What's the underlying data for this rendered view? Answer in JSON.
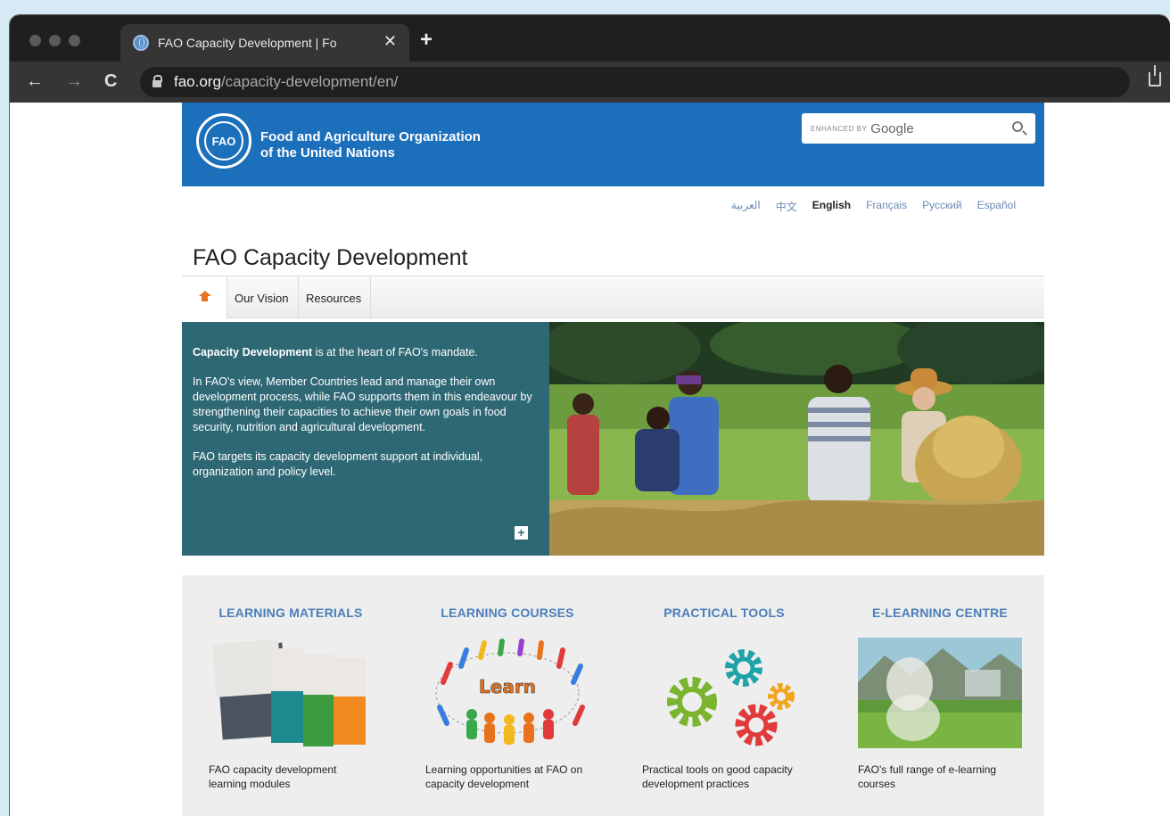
{
  "browser": {
    "tab_title": "FAO Capacity Development | Fo",
    "close_glyph": "✕",
    "new_tab_glyph": "+",
    "back_glyph": "←",
    "forward_glyph": "→",
    "reload_glyph": "C",
    "url_host": "fao.org",
    "url_path": "/capacity-development/en/"
  },
  "header": {
    "org_name_line1": "Food and Agriculture Organization",
    "org_name_line2": "of the United Nations",
    "logo_text": "FAO",
    "search_enhanced": "ENHANCED BY",
    "search_brand": "Google"
  },
  "languages": [
    {
      "label": "العربية",
      "active": false
    },
    {
      "label": "中文",
      "active": false
    },
    {
      "label": "English",
      "active": true
    },
    {
      "label": "Français",
      "active": false
    },
    {
      "label": "Русский",
      "active": false
    },
    {
      "label": "Español",
      "active": false
    }
  ],
  "page_title": "FAO Capacity Development",
  "subnav": {
    "vision": "Our Vision",
    "resources": "Resources"
  },
  "hero": {
    "p1_bold": "Capacity Development",
    "p1_rest": " is at the heart of FAO's mandate.",
    "p2": "In FAO's view, Member Countries lead and manage their own development process, while FAO supports them in this endeavour by strengthening their capacities to achieve their own goals in food security, nutrition and agricultural development.",
    "p3": "FAO targets its capacity development support at individual, organization and policy level.",
    "expand_glyph": "+"
  },
  "cards": [
    {
      "heading": "LEARNING MATERIALS",
      "desc": "FAO capacity development learning modules"
    },
    {
      "heading": "LEARNING COURSES",
      "desc": "Learning opportunities at FAO on capacity development",
      "art_word": "Learn"
    },
    {
      "heading": "PRACTICAL TOOLS",
      "desc": "Practical tools on good capacity development practices"
    },
    {
      "heading": "E-LEARNING CENTRE",
      "desc": "FAO's full range of e-learning courses"
    }
  ],
  "colors": {
    "fao_blue": "#1c6fbb",
    "hero_teal": "#2f6875",
    "card_heading": "#4a7ebb",
    "home_orange": "#e8731c"
  }
}
